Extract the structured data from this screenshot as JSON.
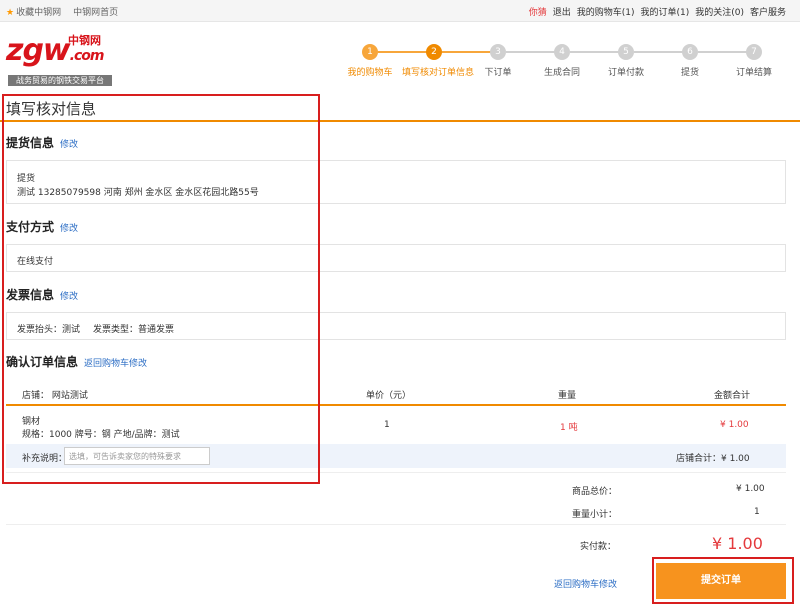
{
  "topbar": {
    "favorite": "收藏中钢网",
    "home": "中钢网首页",
    "user": "你猜",
    "logout": "退出",
    "cart": "我的购物车(1)",
    "orders": "我的订单(1)",
    "follows": "我的关注(0)",
    "service": "客户服务"
  },
  "logo": {
    "brand": "zgw",
    "dotcom": ".com",
    "cn": "中钢网",
    "slogan": "战务贸易的钢铁交易平台"
  },
  "steps": [
    {
      "num": "1",
      "label": "我的购物车",
      "state": "done"
    },
    {
      "num": "2",
      "label": "填写核对订单信息",
      "state": "active"
    },
    {
      "num": "3",
      "label": "下订单",
      "state": "todo"
    },
    {
      "num": "4",
      "label": "生成合同",
      "state": "todo"
    },
    {
      "num": "5",
      "label": "订单付款",
      "state": "todo"
    },
    {
      "num": "6",
      "label": "提货",
      "state": "todo"
    },
    {
      "num": "7",
      "label": "订单结算",
      "state": "todo"
    }
  ],
  "page_title": "填写核对信息",
  "pickup": {
    "title": "提货信息",
    "edit": "修改",
    "method": "提货",
    "address": "测试 13285079598 河南 郑州 金水区 金水区花园北路55号"
  },
  "payment": {
    "title": "支付方式",
    "edit": "修改",
    "value": "在线支付"
  },
  "invoice": {
    "title": "发票信息",
    "edit": "修改",
    "header": "发票抬头：测试",
    "type": "发票类型：普通发票"
  },
  "confirm": {
    "title": "确认订单信息",
    "back_link": "返回购物车修改"
  },
  "table": {
    "store_label": "店铺： 网站测试",
    "col_price": "单价（元）",
    "col_weight": "重量",
    "col_total": "金额合计",
    "item_name": "钢材",
    "item_spec": "规格：1000 牌号：钢 产地/品牌：测试",
    "item_price": "1",
    "item_weight": "1 吨",
    "item_total": "¥ 1.00",
    "note_label": "补充说明：",
    "note_placeholder": "选填，可告诉卖家您的特殊要求",
    "store_subtotal": "店铺合计：¥ 1.00"
  },
  "summary": {
    "goods_label": "商品总价：",
    "goods_value": "¥ 1.00",
    "weight_label": "重量小计：",
    "weight_value": "1",
    "paid_label": "实付款：",
    "paid_value": "¥ 1.00"
  },
  "actions": {
    "back": "返回购物车修改",
    "submit": "提交订单"
  },
  "colors": {
    "accent": "#f08a00",
    "price": "#e4393c",
    "link": "#2a6cc4",
    "highlight": "#d81e1e"
  }
}
